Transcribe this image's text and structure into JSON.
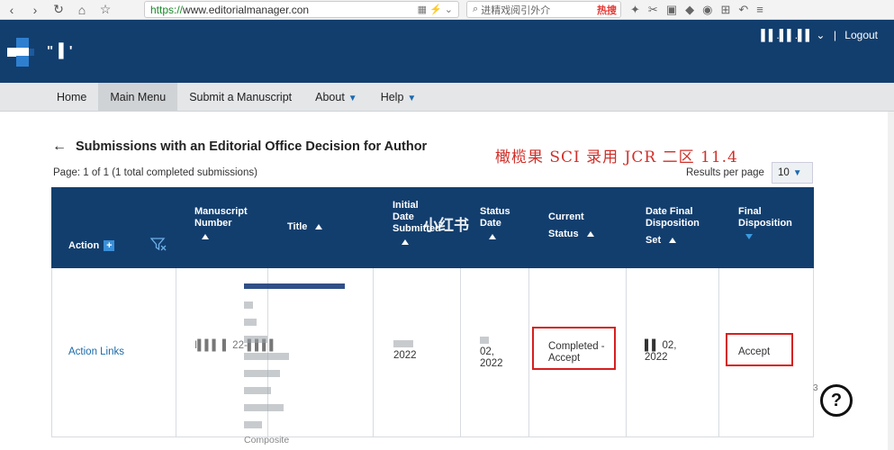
{
  "browser": {
    "url_https": "https://",
    "url_rest": "www.editorialmanager.con",
    "search_text": "进精戏阅引外介",
    "hot_label": "热搜"
  },
  "header": {
    "logo_text": "\" ▌'",
    "user_label": "▌▌.▌▌.▌▌ ⌄",
    "separator": "|",
    "logout": "Logout"
  },
  "nav": {
    "home": "Home",
    "main_menu": "Main Menu",
    "submit": "Submit a Manuscript",
    "about": "About",
    "help": "Help"
  },
  "page": {
    "title": "Submissions with an Editorial Office Decision for Author",
    "overlay_text": "橄榄果 SCI 录用 JCR 二区 11.4",
    "page_info": "Page: 1 of 1 (1 total completed submissions)",
    "results_label": "Results per page",
    "results_value": "10"
  },
  "table": {
    "headers": {
      "action": "Action",
      "manuscript_number_1": "Manuscript",
      "manuscript_number_2": "Number",
      "title": "Title",
      "initial_date_1": "Initial",
      "initial_date_2": "Date",
      "initial_date_3": "Submitted",
      "status_date_1": "Status",
      "status_date_2": "Date",
      "current_status_1": "Current",
      "current_status_2": "Status",
      "date_final_1": "Date Final",
      "date_final_2": "Disposition",
      "date_final_3": "Set",
      "final_disposition_1": "Final",
      "final_disposition_2": "Disposition"
    },
    "row": {
      "action_links": "Action Links",
      "manuscript_number": "I▌▌▌ ▌ 22-▌▌▌▌",
      "title_tail": "Composite",
      "initial_date": "2022",
      "status_date_1": "02,",
      "status_date_2": "2022",
      "current_status_1": "Completed -",
      "current_status_2": "Accept",
      "final_date_1": "▌▌ 02,",
      "final_date_2": "2022",
      "final_disposition": "Accept"
    }
  },
  "watermark": "小红书",
  "help": {
    "label": "?",
    "count": "3"
  },
  "colors": {
    "header_bg": "#123e6e",
    "accent": "#1a6aa8",
    "highlight": "#d61f1f"
  }
}
